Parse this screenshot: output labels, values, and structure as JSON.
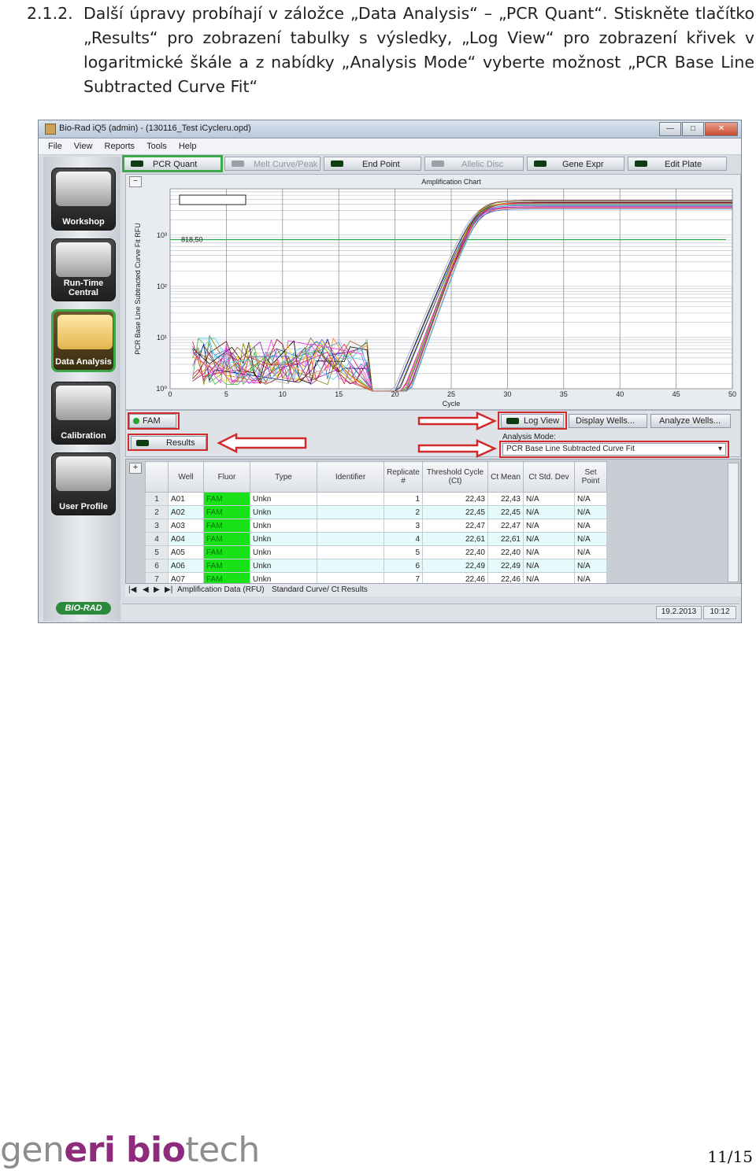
{
  "instruction": {
    "number": "2.1.2.",
    "text": "Další úpravy probíhají v záložce „Data Analysis“ – „PCR Quant“. Stiskněte tlačítko „Results“ pro zobrazení tabulky s výsledky, „Log View“ pro zobrazení křivek v logaritmické škále a z nabídky „Analysis Mode“ vyberte možnost „PCR Base Line Subtracted Curve Fit“"
  },
  "window": {
    "title": "Bio-Rad iQ5 (admin) - (130116_Test iCycleru.opd)",
    "controls": {
      "minimize": "—",
      "maximize": "□",
      "close": "✕"
    }
  },
  "menu": [
    "File",
    "View",
    "Reports",
    "Tools",
    "Help"
  ],
  "sidebar": {
    "items": [
      {
        "label": "Workshop",
        "active": false
      },
      {
        "label": "Run-Time Central",
        "active": false
      },
      {
        "label": "Data Analysis",
        "active": true
      },
      {
        "label": "Calibration",
        "active": false
      },
      {
        "label": "User Profile",
        "active": false
      }
    ],
    "logo": "BIO-RAD"
  },
  "tabs": [
    {
      "label": "PCR Quant",
      "enabled": true,
      "selected": true
    },
    {
      "label": "Melt Curve/Peak",
      "enabled": false,
      "selected": false
    },
    {
      "label": "End Point",
      "enabled": true,
      "selected": false
    },
    {
      "label": "Allelic Disc",
      "enabled": false,
      "selected": false
    },
    {
      "label": "Gene Expr",
      "enabled": true,
      "selected": false
    },
    {
      "label": "Edit Plate",
      "enabled": true,
      "selected": false
    }
  ],
  "chart": {
    "collapse_label": "−",
    "threshold_label": "818,50"
  },
  "chart_data": {
    "type": "line",
    "title": "Amplification Chart",
    "xlabel": "Cycle",
    "ylabel": "PCR Base Line Subtracted Curve Fit RFU",
    "x_ticks": [
      "0",
      "5",
      "10",
      "15",
      "20",
      "25",
      "30",
      "35",
      "40",
      "45",
      "50"
    ],
    "y_ticks": [
      "10⁰",
      "10¹",
      "10²",
      "10³"
    ],
    "y_scale": "log",
    "xlim": [
      0,
      50
    ],
    "ylim": [
      1,
      8000
    ],
    "threshold": 818.5,
    "grid": true,
    "series_summary": "many amplification curves crossing threshold near cycle 22.4–22.6, plateau ≈ 4000 RFU"
  },
  "controls": {
    "fluor_label": "FAM",
    "results_label": "Results",
    "log_view_label": "Log View",
    "display_wells_label": "Display Wells...",
    "analyze_wells_label": "Analyze Wells...",
    "analysis_mode_label": "Analysis Mode:",
    "analysis_mode_value": "PCR Base Line Subtracted Curve Fit",
    "highlight_color": "#d22a2a"
  },
  "table": {
    "add_label": "+",
    "columns": [
      "",
      "Well",
      "Fluor",
      "Type",
      "Identifier",
      "Replicate #",
      "Threshold Cycle (Ct)",
      "Ct Mean",
      "Ct Std. Dev",
      "Set Point"
    ],
    "rows": [
      [
        "1",
        "A01",
        "FAM",
        "Unkn",
        "",
        "1",
        "22,43",
        "22,43",
        "N/A",
        "N/A"
      ],
      [
        "2",
        "A02",
        "FAM",
        "Unkn",
        "",
        "2",
        "22,45",
        "22,45",
        "N/A",
        "N/A"
      ],
      [
        "3",
        "A03",
        "FAM",
        "Unkn",
        "",
        "3",
        "22,47",
        "22,47",
        "N/A",
        "N/A"
      ],
      [
        "4",
        "A04",
        "FAM",
        "Unkn",
        "",
        "4",
        "22,61",
        "22,61",
        "N/A",
        "N/A"
      ],
      [
        "5",
        "A05",
        "FAM",
        "Unkn",
        "",
        "5",
        "22,40",
        "22,40",
        "N/A",
        "N/A"
      ],
      [
        "6",
        "A06",
        "FAM",
        "Unkn",
        "",
        "6",
        "22,49",
        "22,49",
        "N/A",
        "N/A"
      ],
      [
        "7",
        "A07",
        "FAM",
        "Unkn",
        "",
        "7",
        "22,46",
        "22,46",
        "N/A",
        "N/A"
      ]
    ],
    "sheet_tabs": [
      "Amplification Data (RFU)",
      "Standard Curve/ Ct Results"
    ],
    "nav_buttons": [
      "|◀",
      "◀",
      "▶",
      "▶|"
    ]
  },
  "status": {
    "date": "19.2.2013",
    "time": "10:12"
  },
  "footer": {
    "brand_gen": "gen",
    "brand_eri": "eri",
    "brand_space": " ",
    "brand_bio": "bio",
    "brand_tech": "tech",
    "page": "11/15"
  }
}
